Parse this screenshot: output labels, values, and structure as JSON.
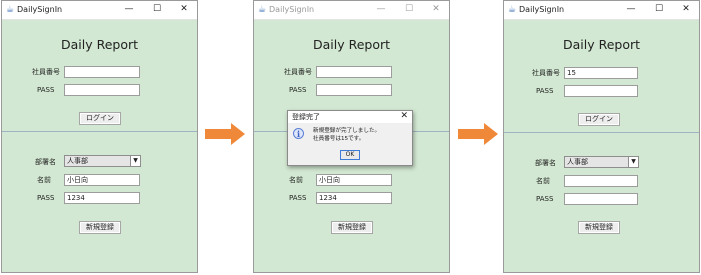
{
  "app": {
    "title": "DailySignIn",
    "heading": "Daily Report",
    "minimize_glyph": "—",
    "maximize_glyph": "☐",
    "close_glyph": "✕"
  },
  "labels": {
    "employee_no": "社員番号",
    "pass": "PASS",
    "department": "部署名",
    "name": "名前"
  },
  "buttons": {
    "login": "ログイン",
    "register": "新規登録"
  },
  "screens": [
    {
      "employee_no": "",
      "pass": "",
      "department": "人事部",
      "name": "小日向",
      "reg_pass": "1234"
    },
    {
      "employee_no": "",
      "pass": "",
      "department": "人事部",
      "name": "小日向",
      "reg_pass": "1234"
    },
    {
      "employee_no": "15",
      "pass": "",
      "department": "人事部",
      "name": "",
      "reg_pass": ""
    }
  ],
  "dialog": {
    "title": "登録完了",
    "close_glyph": "✕",
    "message_line1": "新規登録が完了しました。",
    "message_line2": "社員番号は15です。",
    "ok": "OK",
    "icon_glyph": "i"
  },
  "dropdown_glyph": "▼",
  "arrow_color": "#f0883a",
  "icons": {
    "app": "java-app-icon",
    "info": "info-icon",
    "arrow": "right-arrow-icon"
  }
}
